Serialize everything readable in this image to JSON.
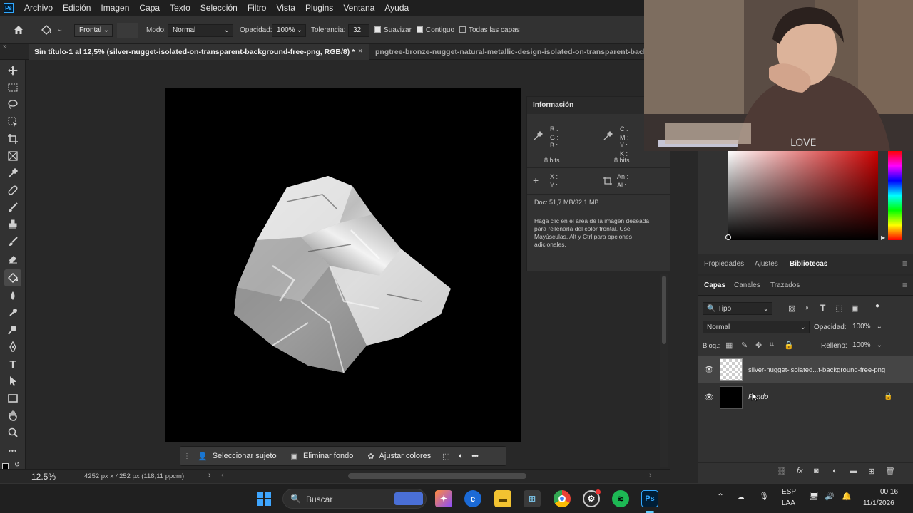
{
  "menubar": {
    "items": [
      "Archivo",
      "Edición",
      "Imagen",
      "Capa",
      "Texto",
      "Selección",
      "Filtro",
      "Vista",
      "Plugins",
      "Ventana",
      "Ayuda"
    ]
  },
  "options": {
    "fill_source": "Frontal",
    "mode_label": "Modo:",
    "mode_value": "Normal",
    "opacity_label": "Opacidad:",
    "opacity_value": "100%",
    "tolerance_label": "Tolerancia:",
    "tolerance_value": "32",
    "smooth_label": "Suavizar",
    "contiguous_label": "Contiguo",
    "all_layers_label": "Todas las capas"
  },
  "tabs": [
    {
      "label": "Sin título-1 al 12,5% (silver-nugget-isolated-on-transparent-background-free-png, RGB/8) *"
    },
    {
      "label": "pngtree-bronze-nugget-natural-metallic-design-isolated-on-transparent-back"
    }
  ],
  "info": {
    "title": "Información",
    "rgb": "R :\nG :\nB :",
    "bits_left": "8 bits",
    "cmyk": "C :\nM :\nY :\nK :",
    "bits_right": "8 bits",
    "xy": "X :\nY :",
    "size": "An :\nAl :",
    "doc": "Doc: 51,7 MB/32,1 MB",
    "help": "Haga clic en el área de la imagen deseada para rellenarla del color frontal. Use Mayúsculas, Alt y Ctrl para opciones adicionales."
  },
  "ctxbar": {
    "select_subject": "Seleccionar sujeto",
    "remove_bg": "Eliminar fondo",
    "adjust_colors": "Ajustar colores",
    "more": "•••"
  },
  "status": {
    "zoom": "12.5%",
    "dims": "4252 px x 4252 px (118,11 ppcm)"
  },
  "panels": {
    "tabs": [
      "Propiedades",
      "Ajustes",
      "Bibliotecas"
    ]
  },
  "layers_panel": {
    "tabs": [
      "Capas",
      "Canales",
      "Trazados"
    ],
    "filter": "Tipo",
    "blend": "Normal",
    "opacity_label": "Opacidad:",
    "opacity_value": "100%",
    "lock_label": "Bloq.:",
    "fill_label": "Relleno:",
    "fill_value": "100%",
    "layers": [
      {
        "name": "silver-nugget-isolated...t-background-free-png"
      },
      {
        "name": "Fondo"
      }
    ]
  },
  "taskbar": {
    "search": "Buscar",
    "lang1": "ESP",
    "lang2": "LAA",
    "time": "00:16",
    "date": "11/1/2026"
  },
  "colors": {
    "accent": "#31a8ff",
    "panel": "#323232",
    "bg": "#282828"
  }
}
